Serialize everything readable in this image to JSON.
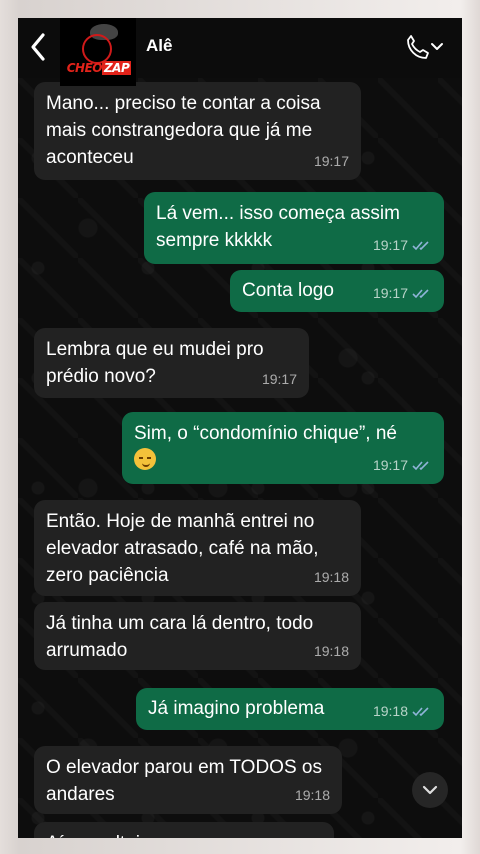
{
  "header": {
    "contact_name": "Alê",
    "logo_text_1": "CHEO",
    "logo_text_2": "ZAP"
  },
  "messages": [
    {
      "dir": "in",
      "text": "Mano... preciso te contar a coisa mais constrangedora que já me aconteceu",
      "time": "19:17"
    },
    {
      "dir": "out",
      "text": "Lá vem... isso começa assim sempre kkkkk",
      "time": "19:17",
      "read": true
    },
    {
      "dir": "out",
      "text": "Conta logo",
      "time": "19:17",
      "read": true
    },
    {
      "dir": "in",
      "text": "Lembra que eu mudei pro prédio novo?",
      "time": "19:17"
    },
    {
      "dir": "out",
      "text": "Sim, o “condomínio chique”, né",
      "emoji": "smirking-face",
      "time": "19:17",
      "read": true
    },
    {
      "dir": "in",
      "text": "Então. Hoje de manhã entrei no elevador atrasado, café na mão, zero paciência",
      "time": "19:18"
    },
    {
      "dir": "in",
      "text": "Já tinha um cara lá dentro, todo arrumado",
      "time": "19:18"
    },
    {
      "dir": "out",
      "text": "Já imagino problema",
      "time": "19:18",
      "read": true
    },
    {
      "dir": "in",
      "text": "O elevador parou em TODOS os andares",
      "time": "19:18"
    },
    {
      "dir": "in",
      "text": "Aí eu soltei, sem pensar:",
      "time": ""
    }
  ],
  "colors": {
    "incoming_bubble": "#222222",
    "outgoing_bubble": "#0f6b46",
    "read_ticks": "#8fb4d8"
  }
}
